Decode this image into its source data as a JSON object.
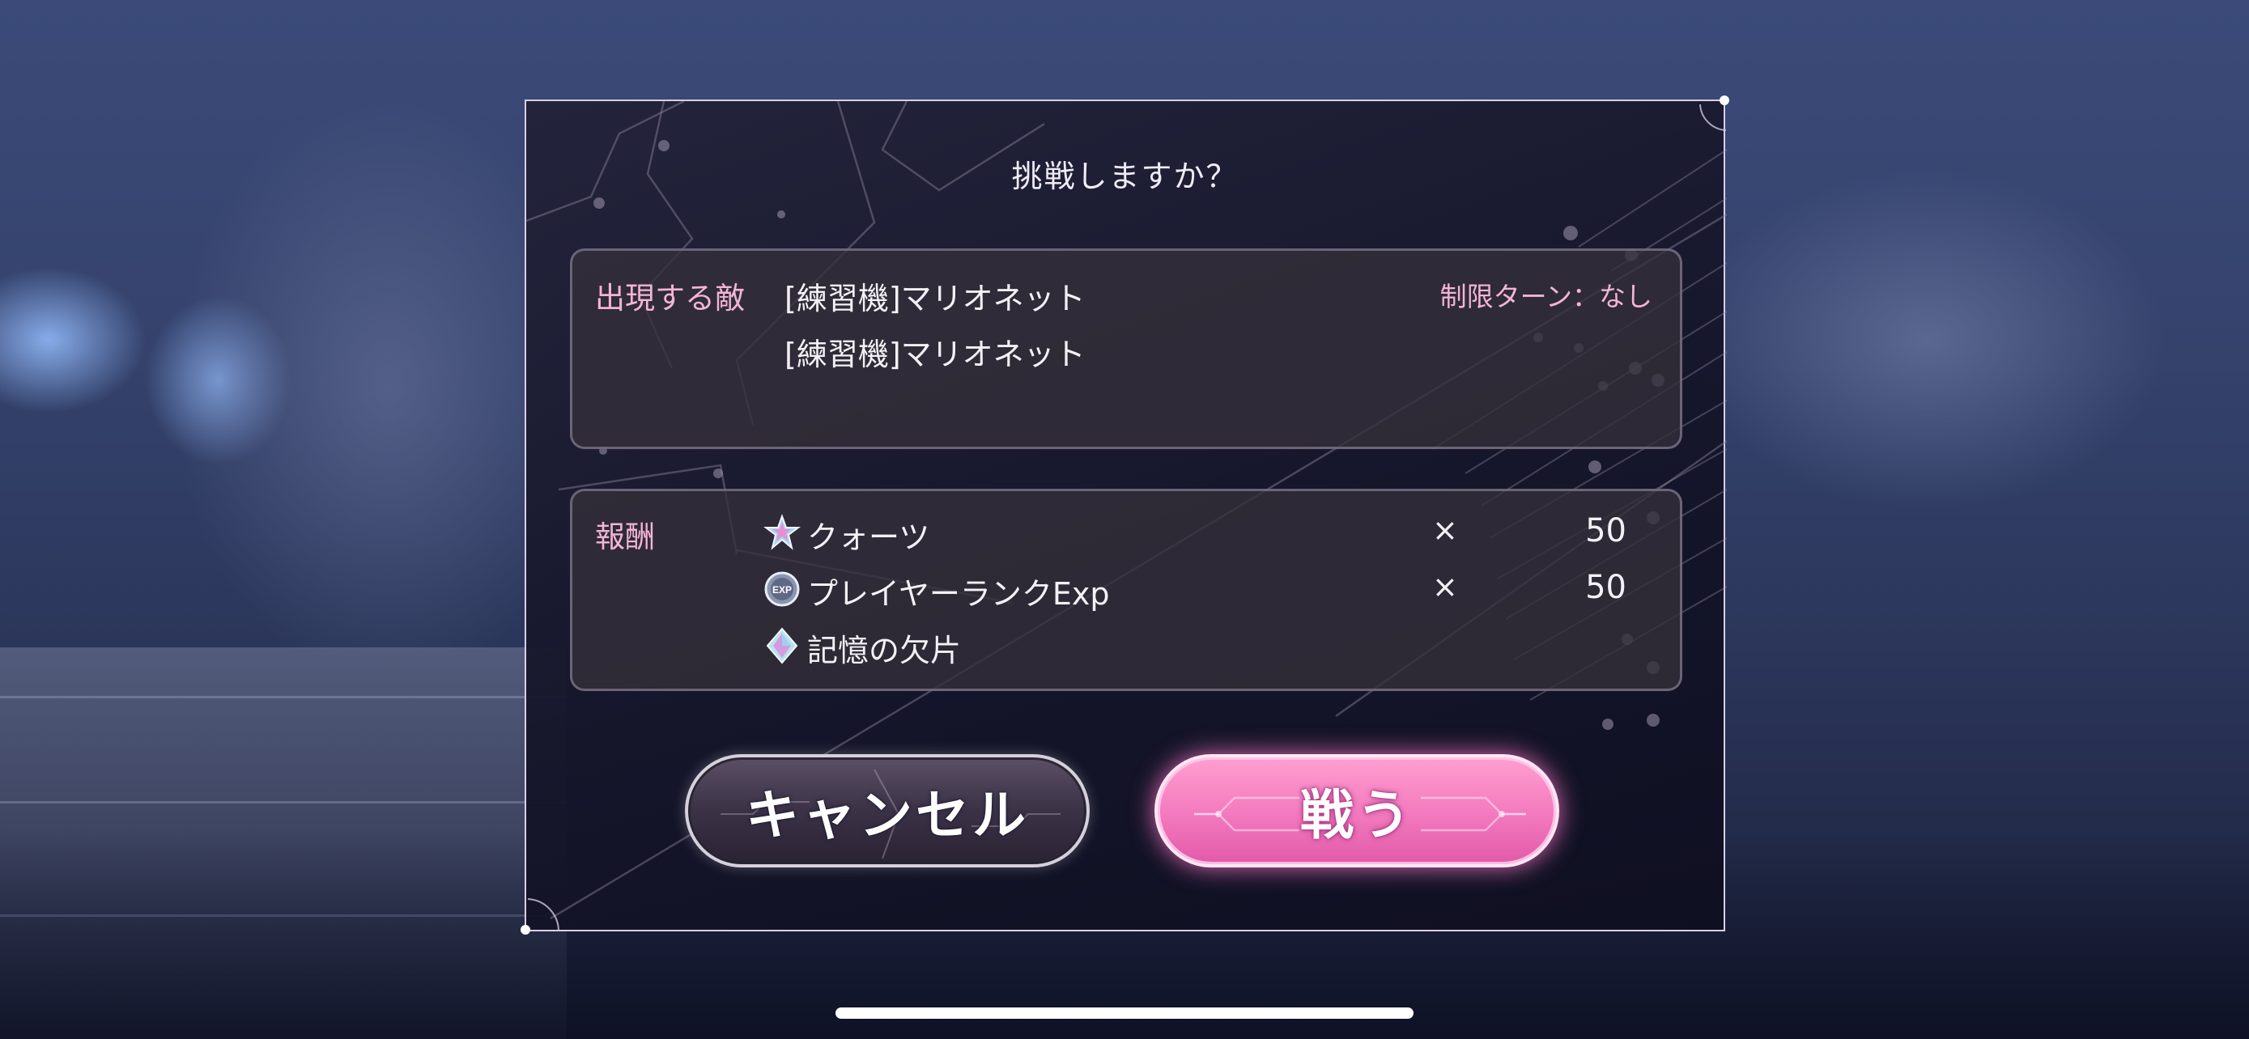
{
  "dialog": {
    "title": "挑戦しますか？"
  },
  "enemy_panel": {
    "label": "出現する敵",
    "enemies": [
      "[練習機]マリオネット",
      "[練習機]マリオネット"
    ],
    "turn_limit": "制限ターン：なし"
  },
  "reward_panel": {
    "label": "報酬",
    "items": [
      {
        "name": "クォーツ",
        "icon": "quartz-star-icon",
        "multiplier": "×",
        "quantity": "50"
      },
      {
        "name": "プレイヤーランクExp",
        "icon": "exp-coin-icon",
        "multiplier": "×",
        "quantity": "50"
      },
      {
        "name": "記憶の欠片",
        "icon": "memory-crystal-icon"
      }
    ]
  },
  "buttons": {
    "cancel": "キャンセル",
    "fight": "戦う"
  },
  "colors": {
    "label_pink": "#f3b4d6",
    "fight_button": "#f47cbf",
    "dialog_border": "#d9d0e4"
  }
}
